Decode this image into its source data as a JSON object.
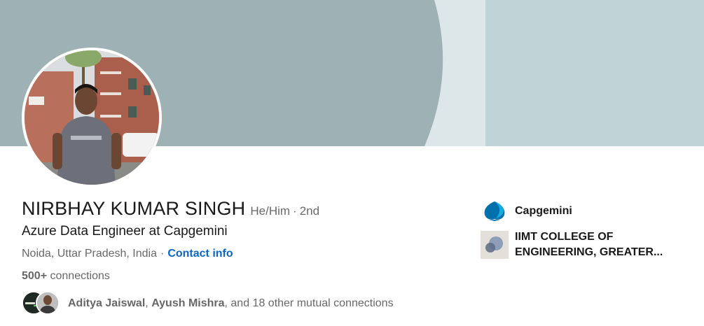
{
  "profile": {
    "name": "NIRBHAY KUMAR SINGH",
    "pronouns": "He/Him",
    "separator": "·",
    "degree": "2nd",
    "headline": "Azure Data Engineer at Capgemini",
    "location": "Noida, Uttar Pradesh, India",
    "contact_info_label": "Contact info",
    "connections_count": "500+",
    "connections_label": "connections"
  },
  "mutual": {
    "person1": "Aditya Jaiswal",
    "comma": ",",
    "person2": "Ayush Mishra",
    "rest": ", and 18 other mutual connections"
  },
  "right_panel": {
    "company": "Capgemini",
    "school": "IIMT COLLEGE OF ENGINEERING, GREATER..."
  },
  "colors": {
    "link": "#0a66c2",
    "banner_dark": "#9eb1b5",
    "banner_light": "#c0d4d8",
    "banner_strip": "#dde6e8",
    "capgemini_blue": "#0070ad"
  },
  "icons": {
    "company_logo": "capgemini-spade-icon",
    "school_logo": "school-logo-icon"
  }
}
